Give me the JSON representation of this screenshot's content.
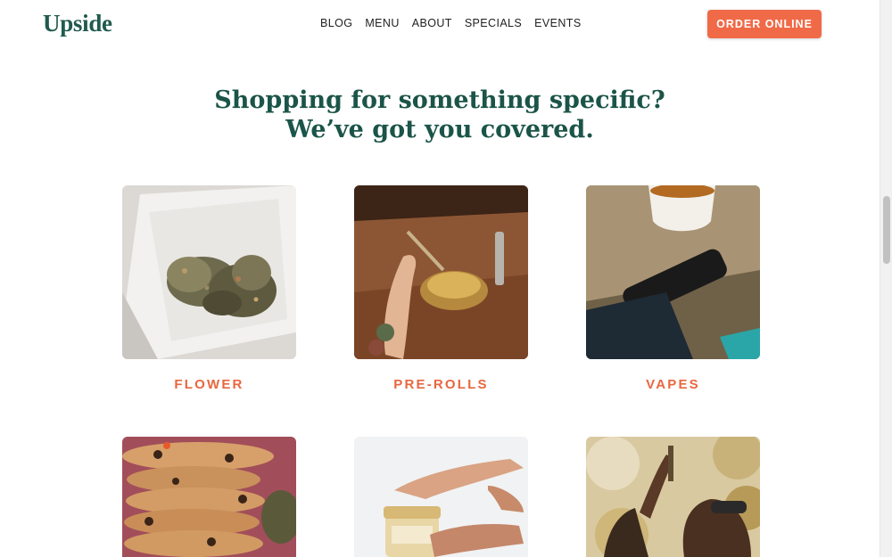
{
  "header": {
    "logo": "Upside",
    "nav": [
      "BLOG",
      "MENU",
      "ABOUT",
      "SPECIALS",
      "EVENTS"
    ],
    "cta": "ORDER ONLINE"
  },
  "main": {
    "headline_line1": "Shopping for something specific?",
    "headline_line2": "We’ve got you covered.",
    "categories": [
      {
        "label": "FLOWER"
      },
      {
        "label": "PRE-ROLLS"
      },
      {
        "label": "VAPES"
      },
      {
        "label": ""
      },
      {
        "label": ""
      },
      {
        "label": ""
      }
    ]
  },
  "colors": {
    "brand_green": "#1b5448",
    "accent_orange": "#f06a48"
  }
}
